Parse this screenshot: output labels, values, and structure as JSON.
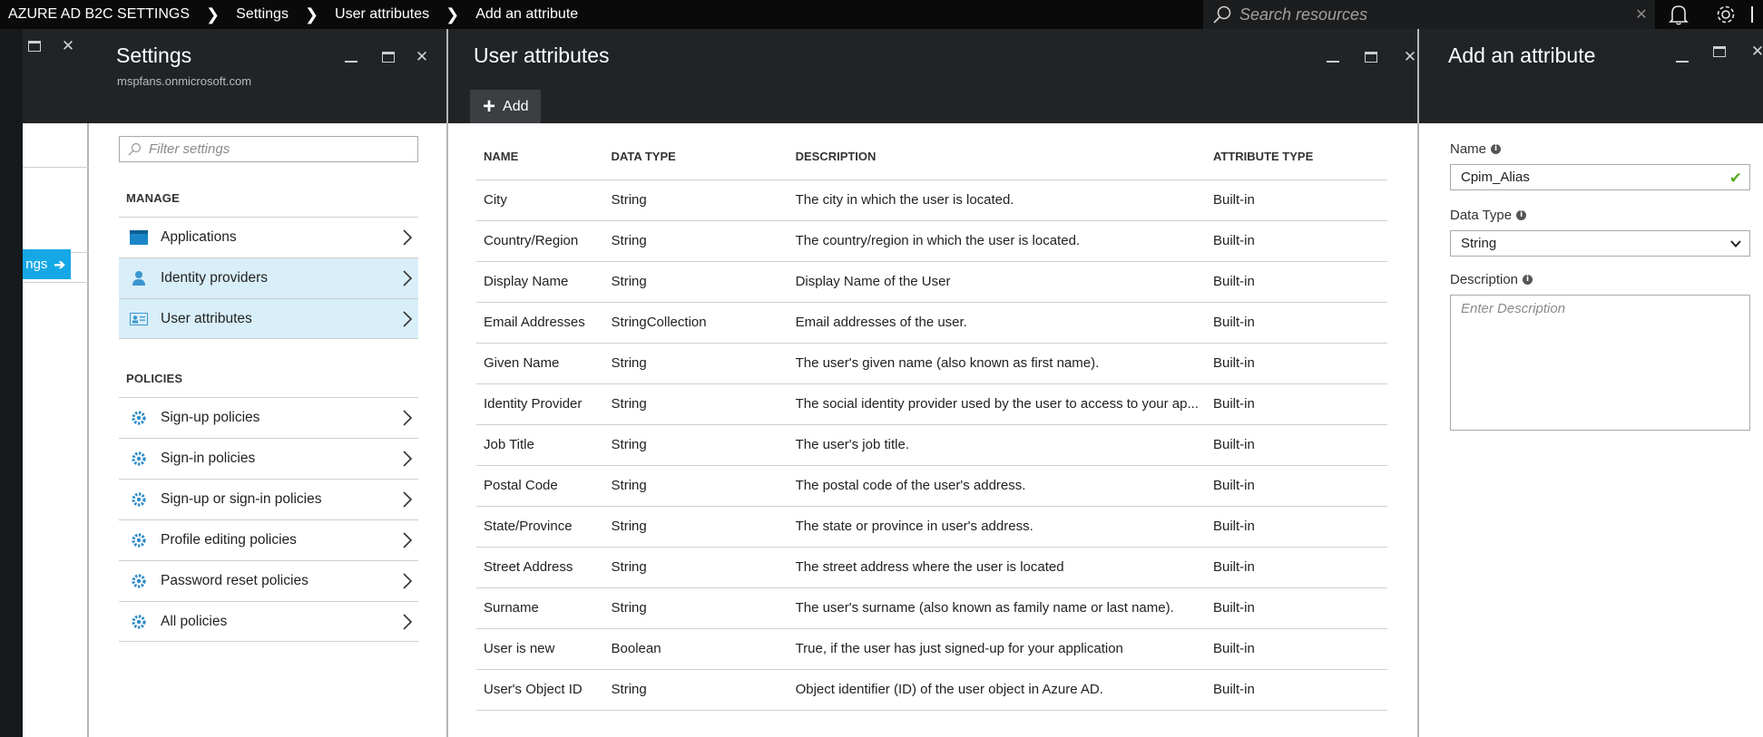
{
  "topbar": {
    "breadcrumbs": [
      "AZURE AD B2C SETTINGS",
      "Settings",
      "User attributes",
      "Add an attribute"
    ],
    "search_placeholder": "Search resources",
    "icons": [
      "notifications-bell-icon",
      "settings-gear-icon"
    ]
  },
  "partial_blade": {
    "button_label": "ngs"
  },
  "settings_blade": {
    "title": "Settings",
    "subtitle": "mspfans.onmicrosoft.com",
    "filter_placeholder": "Filter settings",
    "manage_label": "MANAGE",
    "manage_items": [
      {
        "label": "Applications",
        "icon": "applications-icon"
      },
      {
        "label": "Identity providers",
        "icon": "identity-providers-icon"
      },
      {
        "label": "User attributes",
        "icon": "user-attributes-icon"
      }
    ],
    "policies_label": "POLICIES",
    "policy_items": [
      {
        "label": "Sign-up policies",
        "icon": "gear-icon"
      },
      {
        "label": "Sign-in policies",
        "icon": "gear-icon"
      },
      {
        "label": "Sign-up or sign-in policies",
        "icon": "gear-icon"
      },
      {
        "label": "Profile editing policies",
        "icon": "gear-icon"
      },
      {
        "label": "Password reset policies",
        "icon": "gear-icon"
      },
      {
        "label": "All policies",
        "icon": "gear-icon"
      }
    ]
  },
  "user_attributes_blade": {
    "title": "User attributes",
    "add_label": "Add",
    "columns": [
      "NAME",
      "DATA TYPE",
      "DESCRIPTION",
      "ATTRIBUTE TYPE"
    ],
    "rows": [
      [
        "City",
        "String",
        "The city in which the user is located.",
        "Built-in"
      ],
      [
        "Country/Region",
        "String",
        "The country/region in which the user is located.",
        "Built-in"
      ],
      [
        "Display Name",
        "String",
        "Display Name of the User",
        "Built-in"
      ],
      [
        "Email Addresses",
        "StringCollection",
        "Email addresses of the user.",
        "Built-in"
      ],
      [
        "Given Name",
        "String",
        "The user's given name (also known as first name).",
        "Built-in"
      ],
      [
        "Identity Provider",
        "String",
        "The social identity provider used by the user to access to your ap...",
        "Built-in"
      ],
      [
        "Job Title",
        "String",
        "The user's job title.",
        "Built-in"
      ],
      [
        "Postal Code",
        "String",
        "The postal code of the user's address.",
        "Built-in"
      ],
      [
        "State/Province",
        "String",
        "The state or province in user's address.",
        "Built-in"
      ],
      [
        "Street Address",
        "String",
        "The street address where the user is located",
        "Built-in"
      ],
      [
        "Surname",
        "String",
        "The user's surname (also known as family name or last name).",
        "Built-in"
      ],
      [
        "User is new",
        "Boolean",
        "True, if the user has just signed-up for your application",
        "Built-in"
      ],
      [
        "User's Object ID",
        "String",
        "Object identifier (ID) of the user object in Azure AD.",
        "Built-in"
      ]
    ]
  },
  "add_attribute_blade": {
    "title": "Add an attribute",
    "name_label": "Name",
    "name_value": "Cpim_Alias",
    "data_type_label": "Data Type",
    "data_type_value": "String",
    "description_label": "Description",
    "description_placeholder": "Enter Description"
  },
  "colors": {
    "topbar": "#0a0a0a",
    "blade_header": "#212427",
    "selected_item": "#d8eef9",
    "accent": "#16a8e6",
    "valid_check": "#5aaa1f"
  }
}
